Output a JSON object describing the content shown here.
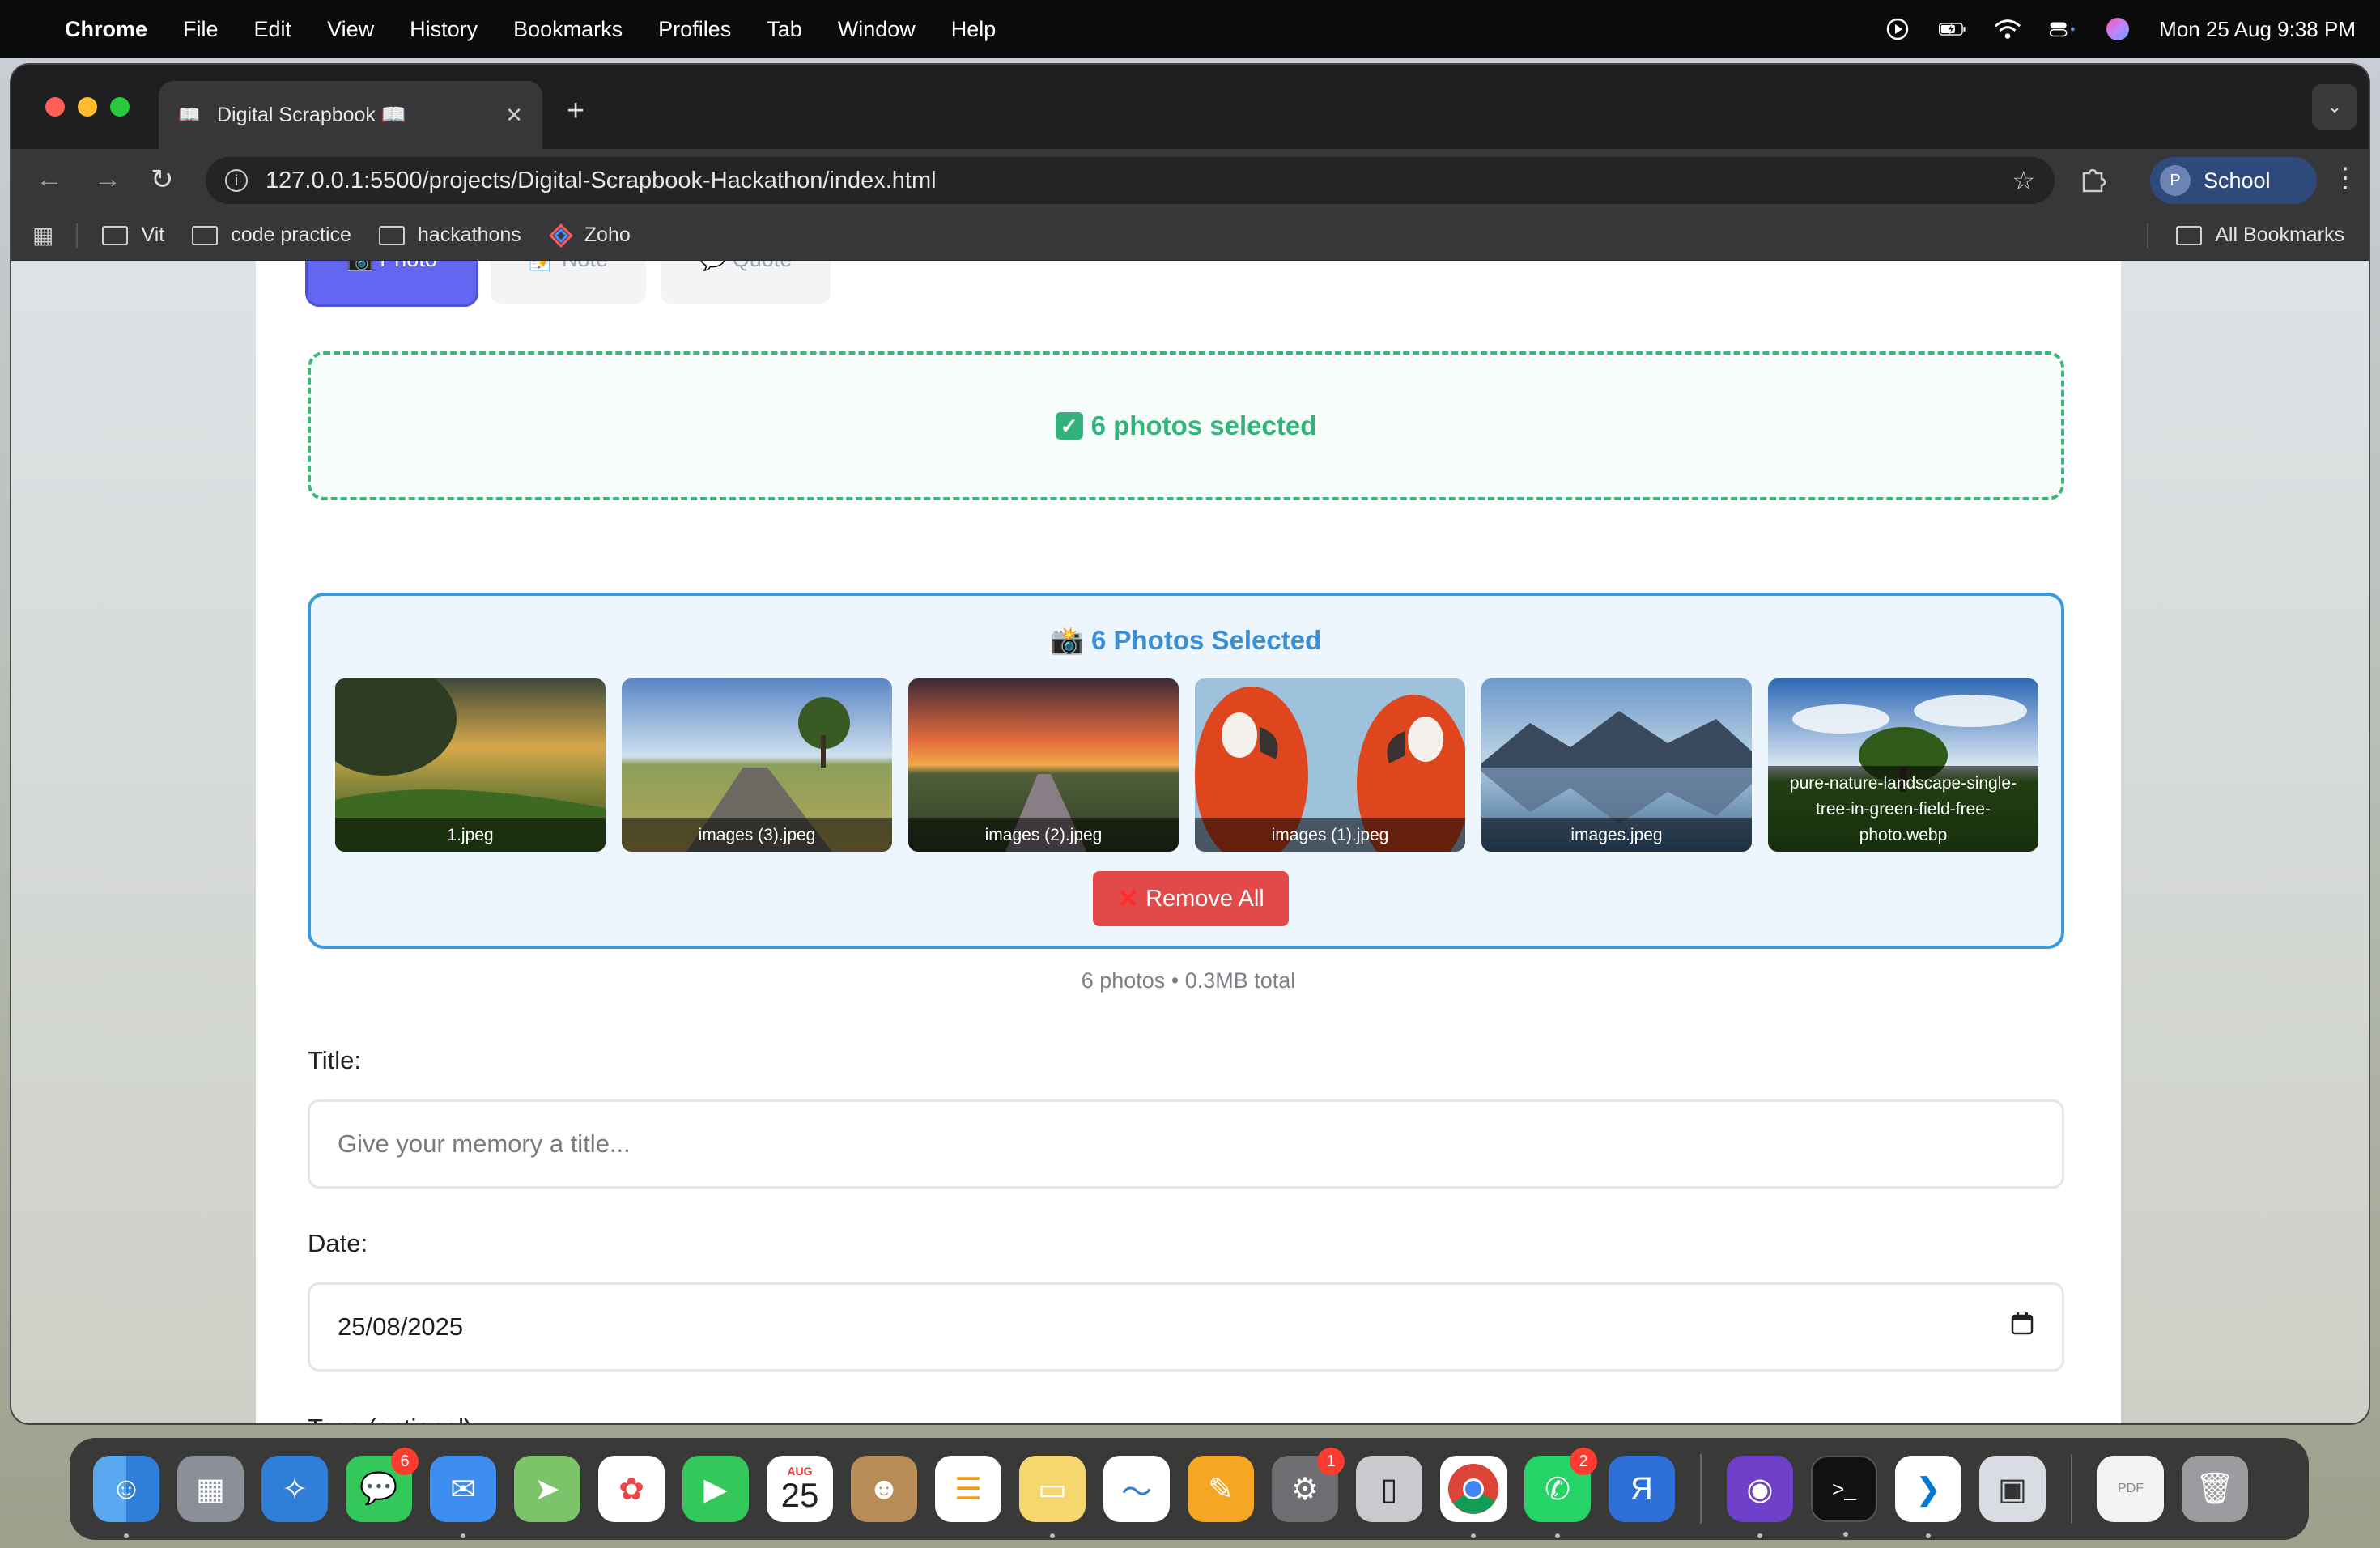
{
  "menubar": {
    "app": "Chrome",
    "items": [
      "File",
      "Edit",
      "View",
      "History",
      "Bookmarks",
      "Profiles",
      "Tab",
      "Window",
      "Help"
    ],
    "datetime": "Mon 25 Aug  9:38 PM"
  },
  "browser": {
    "tab_title": "Digital Scrapbook 📖",
    "url": "127.0.0.1:5500/projects/Digital-Scrapbook-Hackathon/index.html",
    "profile_initial": "P",
    "profile_label": "School",
    "bookmarks": [
      "Vit",
      "code practice",
      "hackathons",
      "Zoho"
    ],
    "all_bookmarks": "All Bookmarks"
  },
  "form": {
    "type_buttons": [
      {
        "label": "📷 Photo",
        "active": true
      },
      {
        "label": "📝 Note",
        "active": false
      },
      {
        "label": "💬 Quote",
        "active": false
      }
    ],
    "dropzone_text": "6 photos selected",
    "preview_title": "📸 6 Photos Selected",
    "photos": [
      {
        "name": "1.jpeg"
      },
      {
        "name": "images (3).jpeg"
      },
      {
        "name": "images (2).jpeg"
      },
      {
        "name": "images (1).jpeg"
      },
      {
        "name": "images.jpeg"
      },
      {
        "name": "pure-nature-landscape-single-tree-in-green-field-free-photo.webp"
      }
    ],
    "remove_all": "Remove All",
    "summary": "6 photos • 0.3MB total",
    "title_label": "Title:",
    "title_placeholder": "Give your memory a title...",
    "date_label": "Date:",
    "date_value": "25/08/2025",
    "tags_label": "Tags (optional):"
  },
  "dock": {
    "calendar_month": "AUG",
    "calendar_day": "25",
    "badges": {
      "messages": "6",
      "settings": "1",
      "whatsapp": "2"
    }
  }
}
